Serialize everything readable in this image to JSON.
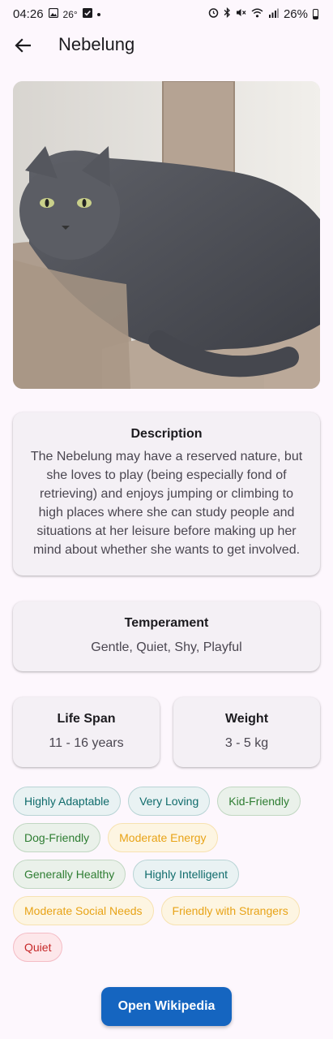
{
  "status_bar": {
    "time": "04:26",
    "temperature": "26°",
    "battery_percent": "26%"
  },
  "app_bar": {
    "title": "Nebelung"
  },
  "photo": {
    "subject": "grey-long-haired-cat"
  },
  "description": {
    "heading": "Description",
    "text": "The Nebelung may have a reserved nature, but she loves to play (being especially fond of retrieving) and enjoys jumping or climbing to high places where she can study people and situations at her leisure before making up her mind about whether she wants to get involved."
  },
  "temperament": {
    "heading": "Temperament",
    "text": "Gentle, Quiet, Shy, Playful"
  },
  "life_span": {
    "heading": "Life Span",
    "text": "11 - 16 years"
  },
  "weight": {
    "heading": "Weight",
    "text": "3 - 5 kg"
  },
  "chips": [
    {
      "label": "Highly Adaptable",
      "tone": "teal"
    },
    {
      "label": "Very Loving",
      "tone": "teal"
    },
    {
      "label": "Kid-Friendly",
      "tone": "green"
    },
    {
      "label": "Dog-Friendly",
      "tone": "green"
    },
    {
      "label": "Moderate Energy",
      "tone": "yellow"
    },
    {
      "label": "Generally Healthy",
      "tone": "green"
    },
    {
      "label": "Highly Intelligent",
      "tone": "teal"
    },
    {
      "label": "Moderate Social Needs",
      "tone": "yellow"
    },
    {
      "label": "Friendly with Strangers",
      "tone": "yellow"
    },
    {
      "label": "Quiet",
      "tone": "red"
    }
  ],
  "actions": {
    "open_wikipedia": "Open Wikipedia"
  },
  "colors": {
    "primary_button": "#1565c0",
    "background": "#fdf7fd",
    "card": "#f4f0f5"
  }
}
